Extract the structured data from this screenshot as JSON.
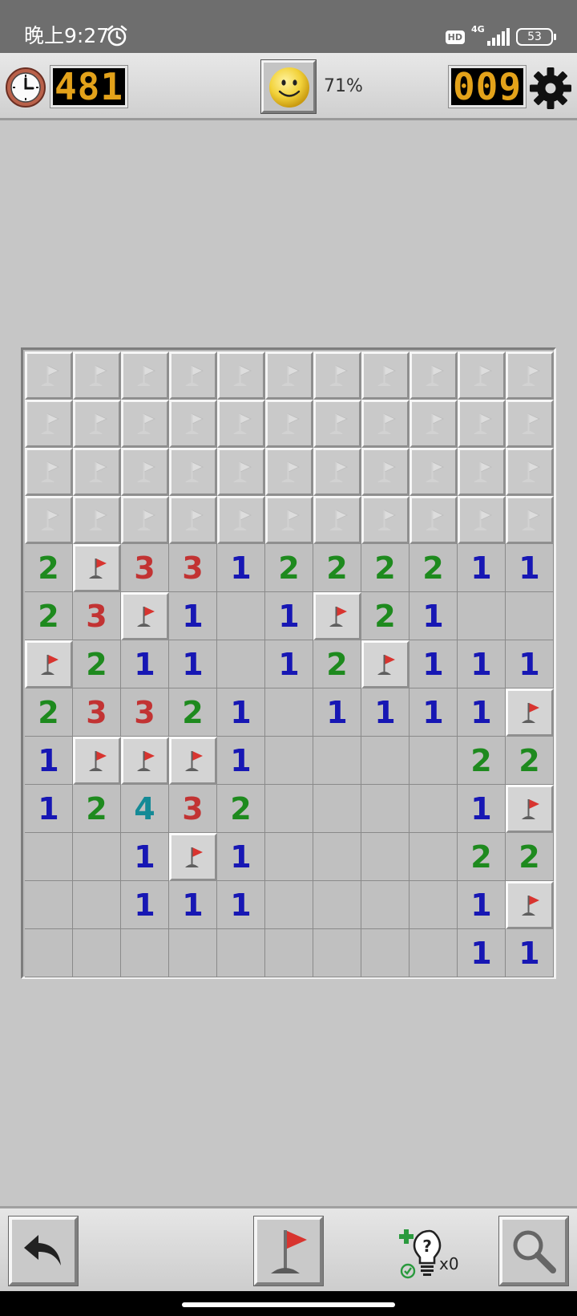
{
  "status_bar": {
    "time": "晚上9:27",
    "hd_label": "HD",
    "network": "4G",
    "battery": "53",
    "icons": [
      "alarm-icon",
      "hd-icon",
      "signal-icon",
      "battery-icon"
    ]
  },
  "header": {
    "timer": "481",
    "progress": "71%",
    "mines_left": "009",
    "icons": [
      "clock-icon",
      "smiley-icon",
      "gear-icon"
    ]
  },
  "board": {
    "cols": 11,
    "rows": 13,
    "legend": "C = closed, F = flagged, 0 = empty open, digits = number",
    "cells": [
      [
        "C",
        "C",
        "C",
        "C",
        "C",
        "C",
        "C",
        "C",
        "C",
        "C",
        "C"
      ],
      [
        "C",
        "C",
        "C",
        "C",
        "C",
        "C",
        "C",
        "C",
        "C",
        "C",
        "C"
      ],
      [
        "C",
        "C",
        "C",
        "C",
        "C",
        "C",
        "C",
        "C",
        "C",
        "C",
        "C"
      ],
      [
        "C",
        "C",
        "C",
        "C",
        "C",
        "C",
        "C",
        "C",
        "C",
        "C",
        "C"
      ],
      [
        "2",
        "F",
        "3",
        "3",
        "1",
        "2",
        "2",
        "2",
        "2",
        "1",
        "1"
      ],
      [
        "2",
        "3",
        "F",
        "1",
        "0",
        "1",
        "F",
        "2",
        "1",
        "0",
        "0"
      ],
      [
        "F",
        "2",
        "1",
        "1",
        "0",
        "1",
        "2",
        "F",
        "1",
        "1",
        "1"
      ],
      [
        "2",
        "3",
        "3",
        "2",
        "1",
        "0",
        "1",
        "1",
        "1",
        "1",
        "F"
      ],
      [
        "1",
        "F",
        "F",
        "F",
        "1",
        "0",
        "0",
        "0",
        "0",
        "2",
        "2"
      ],
      [
        "1",
        "2",
        "4",
        "3",
        "2",
        "0",
        "0",
        "0",
        "0",
        "1",
        "F"
      ],
      [
        "0",
        "0",
        "1",
        "F",
        "1",
        "0",
        "0",
        "0",
        "0",
        "2",
        "2"
      ],
      [
        "0",
        "0",
        "1",
        "1",
        "1",
        "0",
        "0",
        "0",
        "0",
        "1",
        "F"
      ],
      [
        "0",
        "0",
        "0",
        "0",
        "0",
        "0",
        "0",
        "0",
        "0",
        "1",
        "1"
      ]
    ],
    "number_colors": {
      "1": "#1717b4",
      "2": "#1e8a1e",
      "3": "#c23333",
      "4": "#148a96"
    }
  },
  "footer": {
    "hint_count": "x0",
    "icons": [
      "undo-icon",
      "flag-mode-icon",
      "hint-bulb-icon",
      "magnifier-icon"
    ]
  }
}
